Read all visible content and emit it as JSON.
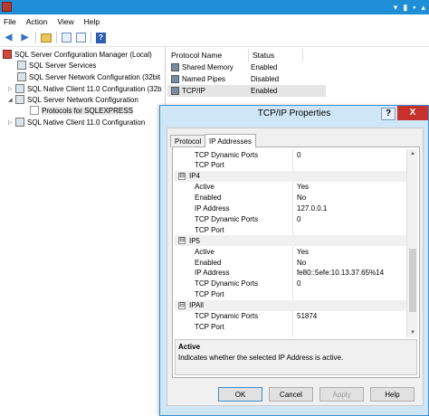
{
  "window": {
    "title": ""
  },
  "menu": [
    "File",
    "Action",
    "View",
    "Help"
  ],
  "toolbar": {
    "back_icon": "arrow-left-icon",
    "forward_icon": "arrow-right-icon",
    "help_glyph": "?"
  },
  "tree": {
    "items": [
      {
        "label": "SQL Server Configuration Manager (Local)"
      },
      {
        "label": "SQL Server Services"
      },
      {
        "label": "SQL Server Network Configuration (32bit"
      },
      {
        "label": "SQL Native Client 11.0 Configuration (32b"
      },
      {
        "label": "SQL Server Network Configuration"
      },
      {
        "label": "Protocols for SQLEXPRESS"
      },
      {
        "label": "SQL Native Client 11.0 Configuration"
      }
    ]
  },
  "list": {
    "headers": [
      "Protocol Name",
      "Status"
    ],
    "rows": [
      {
        "name": "Shared Memory",
        "status": "Enabled"
      },
      {
        "name": "Named Pipes",
        "status": "Disabled"
      },
      {
        "name": "TCP/IP",
        "status": "Enabled"
      }
    ]
  },
  "dialog": {
    "title": "TCP/IP Properties",
    "help_glyph": "?",
    "close_glyph": "X",
    "tabs": [
      "Protocol",
      "IP Addresses"
    ],
    "properties": [
      {
        "type": "prop",
        "key": "TCP Dynamic Ports",
        "value": "0"
      },
      {
        "type": "prop",
        "key": "TCP Port",
        "value": ""
      },
      {
        "type": "group",
        "name": "IP4",
        "toggle": "⊟"
      },
      {
        "type": "prop",
        "key": "Active",
        "value": "Yes"
      },
      {
        "type": "prop",
        "key": "Enabled",
        "value": "No"
      },
      {
        "type": "prop",
        "key": "IP Address",
        "value": "127.0.0.1"
      },
      {
        "type": "prop",
        "key": "TCP Dynamic Ports",
        "value": "0"
      },
      {
        "type": "prop",
        "key": "TCP Port",
        "value": ""
      },
      {
        "type": "group",
        "name": "IP5",
        "toggle": "⊟"
      },
      {
        "type": "prop",
        "key": "Active",
        "value": "Yes"
      },
      {
        "type": "prop",
        "key": "Enabled",
        "value": "No"
      },
      {
        "type": "prop",
        "key": "IP Address",
        "value": "fe80::5efe:10.13.37.65%14"
      },
      {
        "type": "prop",
        "key": "TCP Dynamic Ports",
        "value": "0"
      },
      {
        "type": "prop",
        "key": "TCP Port",
        "value": ""
      },
      {
        "type": "group",
        "name": "IPAll",
        "toggle": "⊟"
      },
      {
        "type": "prop",
        "key": "TCP Dynamic Ports",
        "value": "51874"
      },
      {
        "type": "prop",
        "key": "TCP Port",
        "value": ""
      }
    ],
    "description": {
      "title": "Active",
      "text": "Indicates whether the selected IP Address is active."
    },
    "buttons": {
      "ok": "OK",
      "cancel": "Cancel",
      "apply": "Apply",
      "help": "Help"
    }
  }
}
